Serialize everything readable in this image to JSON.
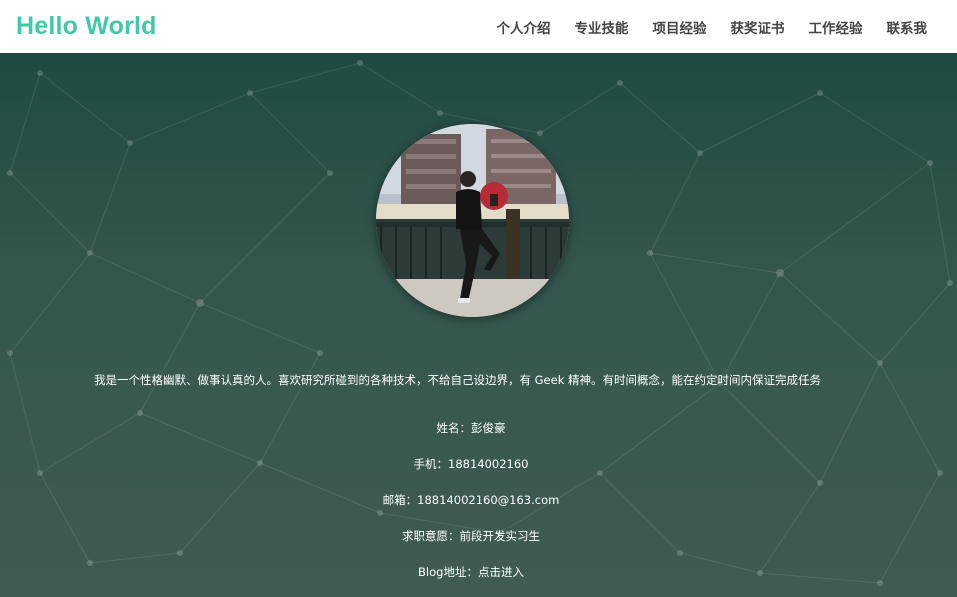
{
  "brand": "Hello World",
  "nav": [
    {
      "label": "个人介绍"
    },
    {
      "label": "专业技能"
    },
    {
      "label": "项目经验"
    },
    {
      "label": "获奖证书"
    },
    {
      "label": "工作经验"
    },
    {
      "label": "联系我"
    }
  ],
  "profile": {
    "intro": "我是一个性格幽默、做事认真的人。喜欢研究所碰到的各种技术，不给自己设边界，有 Geek 精神。有时间概念，能在约定时间内保证完成任务",
    "name_line": "姓名：彭俊豪",
    "phone_line": "手机：18814002160",
    "email_line": "邮箱：18814002160@163.com",
    "intent_line": "求职意愿：前段开发实习生",
    "blog_prefix": "Blog地址：",
    "blog_link": "点击进入"
  },
  "colors": {
    "brand": "#3fc9a8",
    "hero_top": "#1f4a42",
    "hero_bottom": "#3f5b54"
  }
}
